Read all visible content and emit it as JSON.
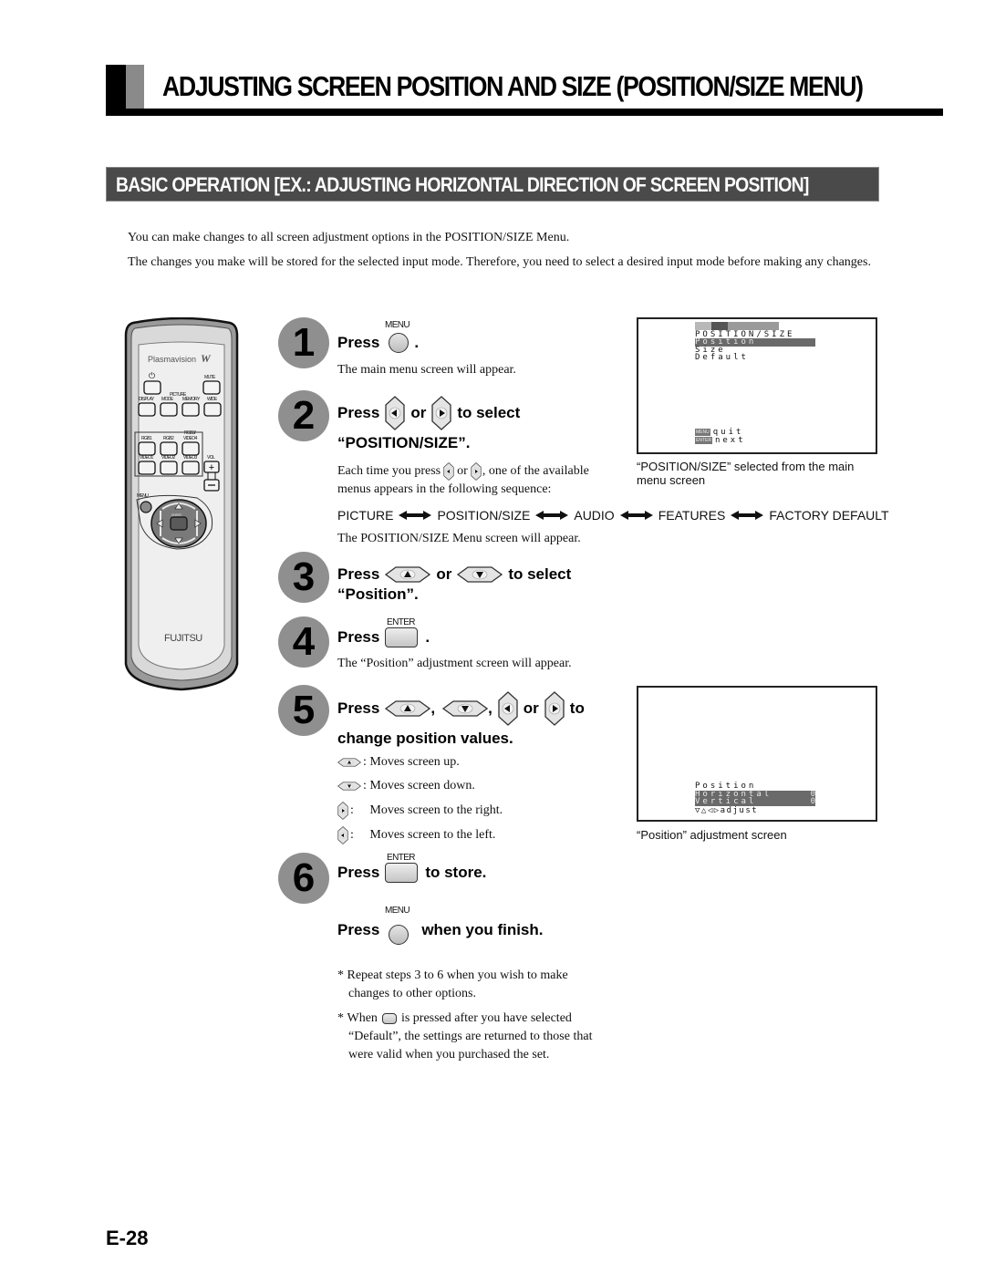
{
  "header": {
    "title": "ADJUSTING SCREEN POSITION AND SIZE (POSITION/SIZE MENU)",
    "section": "BASIC OPERATION [EX.: ADJUSTING HORIZONTAL DIRECTION OF SCREEN POSITION]"
  },
  "intro": {
    "p1": "You can make changes to all screen adjustment options in the POSITION/SIZE Menu.",
    "p2": "The changes you make will be stored for the selected input mode.  Therefore, you need to select a desired input mode before making any changes."
  },
  "remote": {
    "brand_model": "Plasmavision",
    "brand_mark": "W",
    "manufacturer": "FUJITSU",
    "buttons": {
      "power": "⏻",
      "mute": "MUTE",
      "display": "DISPLAY",
      "picture_group": "PICTURE",
      "mode": "MODE",
      "memory": "MEMORY",
      "wide": "WIDE",
      "rgb1": "RGB1",
      "rgb2": "RGB2",
      "rgb3": "RGB3/",
      "video4": "VIDEO4",
      "video1": "VIDEO1",
      "video2": "VIDEO2",
      "video3": "VIDEO3",
      "vol": "VOL",
      "vol_plus": "+",
      "vol_minus": "−",
      "menu": "MENU",
      "enter": "ENTER"
    }
  },
  "labels": {
    "menu": "MENU",
    "enter": "ENTER",
    "press": "Press",
    "or": "or",
    "comma": ",",
    "period": "."
  },
  "steps": [
    {
      "num": "1",
      "head_suffix": ".",
      "desc": "The main menu screen will appear."
    },
    {
      "num": "2",
      "head_suffix": "to select",
      "head_line2": "“POSITION/SIZE”.",
      "desc": "Each time you press",
      "desc_or": "or",
      "desc_rest": ", one of the available",
      "desc_line2": "menus appears in the following sequence:",
      "after_seq": "The POSITION/SIZE Menu screen will appear."
    },
    {
      "num": "3",
      "head_suffix": "to select",
      "head_line2": "“Position”."
    },
    {
      "num": "4",
      "head_suffix": ".",
      "desc": "The “Position” adjustment screen will appear."
    },
    {
      "num": "5",
      "head_suffix": "to",
      "head_line2": "change position values.",
      "legend": [
        {
          "key": "up",
          "text": ": Moves screen up."
        },
        {
          "key": "down",
          "text": ": Moves screen down."
        },
        {
          "key": "right",
          "text": ":     Moves screen to the right."
        },
        {
          "key": "left",
          "text": ":     Moves screen to the left."
        }
      ]
    },
    {
      "num": "6",
      "head_suffix": "to store.",
      "head2_suffix": "when you finish."
    }
  ],
  "sequence": [
    "PICTURE",
    "POSITION/SIZE",
    "AUDIO",
    "FEATURES",
    "FACTORY DEFAULT"
  ],
  "notes": [
    {
      "bullet": "*",
      "line1": "Repeat steps 3 to 6 when you wish to make",
      "line2": "changes to other options."
    },
    {
      "bullet": "*",
      "pre": "When",
      "line1": "is pressed after you have selected",
      "line2": "“Default”, the settings are returned to those that",
      "line3": "were valid when you purchased the set."
    }
  ],
  "osd_main": {
    "title": "POSITION/SIZE",
    "items": [
      "Position",
      "Size",
      "Default"
    ],
    "selected": "Position",
    "footer": [
      {
        "key": "MENU",
        "action": "quit"
      },
      {
        "key": "ENTER",
        "action": "next"
      }
    ],
    "caption": "“POSITION/SIZE” selected from the main menu screen"
  },
  "osd_position": {
    "title": "Position",
    "rows": [
      {
        "label": "Horizontal",
        "value": "0"
      },
      {
        "label": "Vertical",
        "value": "0"
      }
    ],
    "footer": "▽△◁▷adjust",
    "caption": "“Position” adjustment screen"
  },
  "page": {
    "number": "E-28"
  }
}
